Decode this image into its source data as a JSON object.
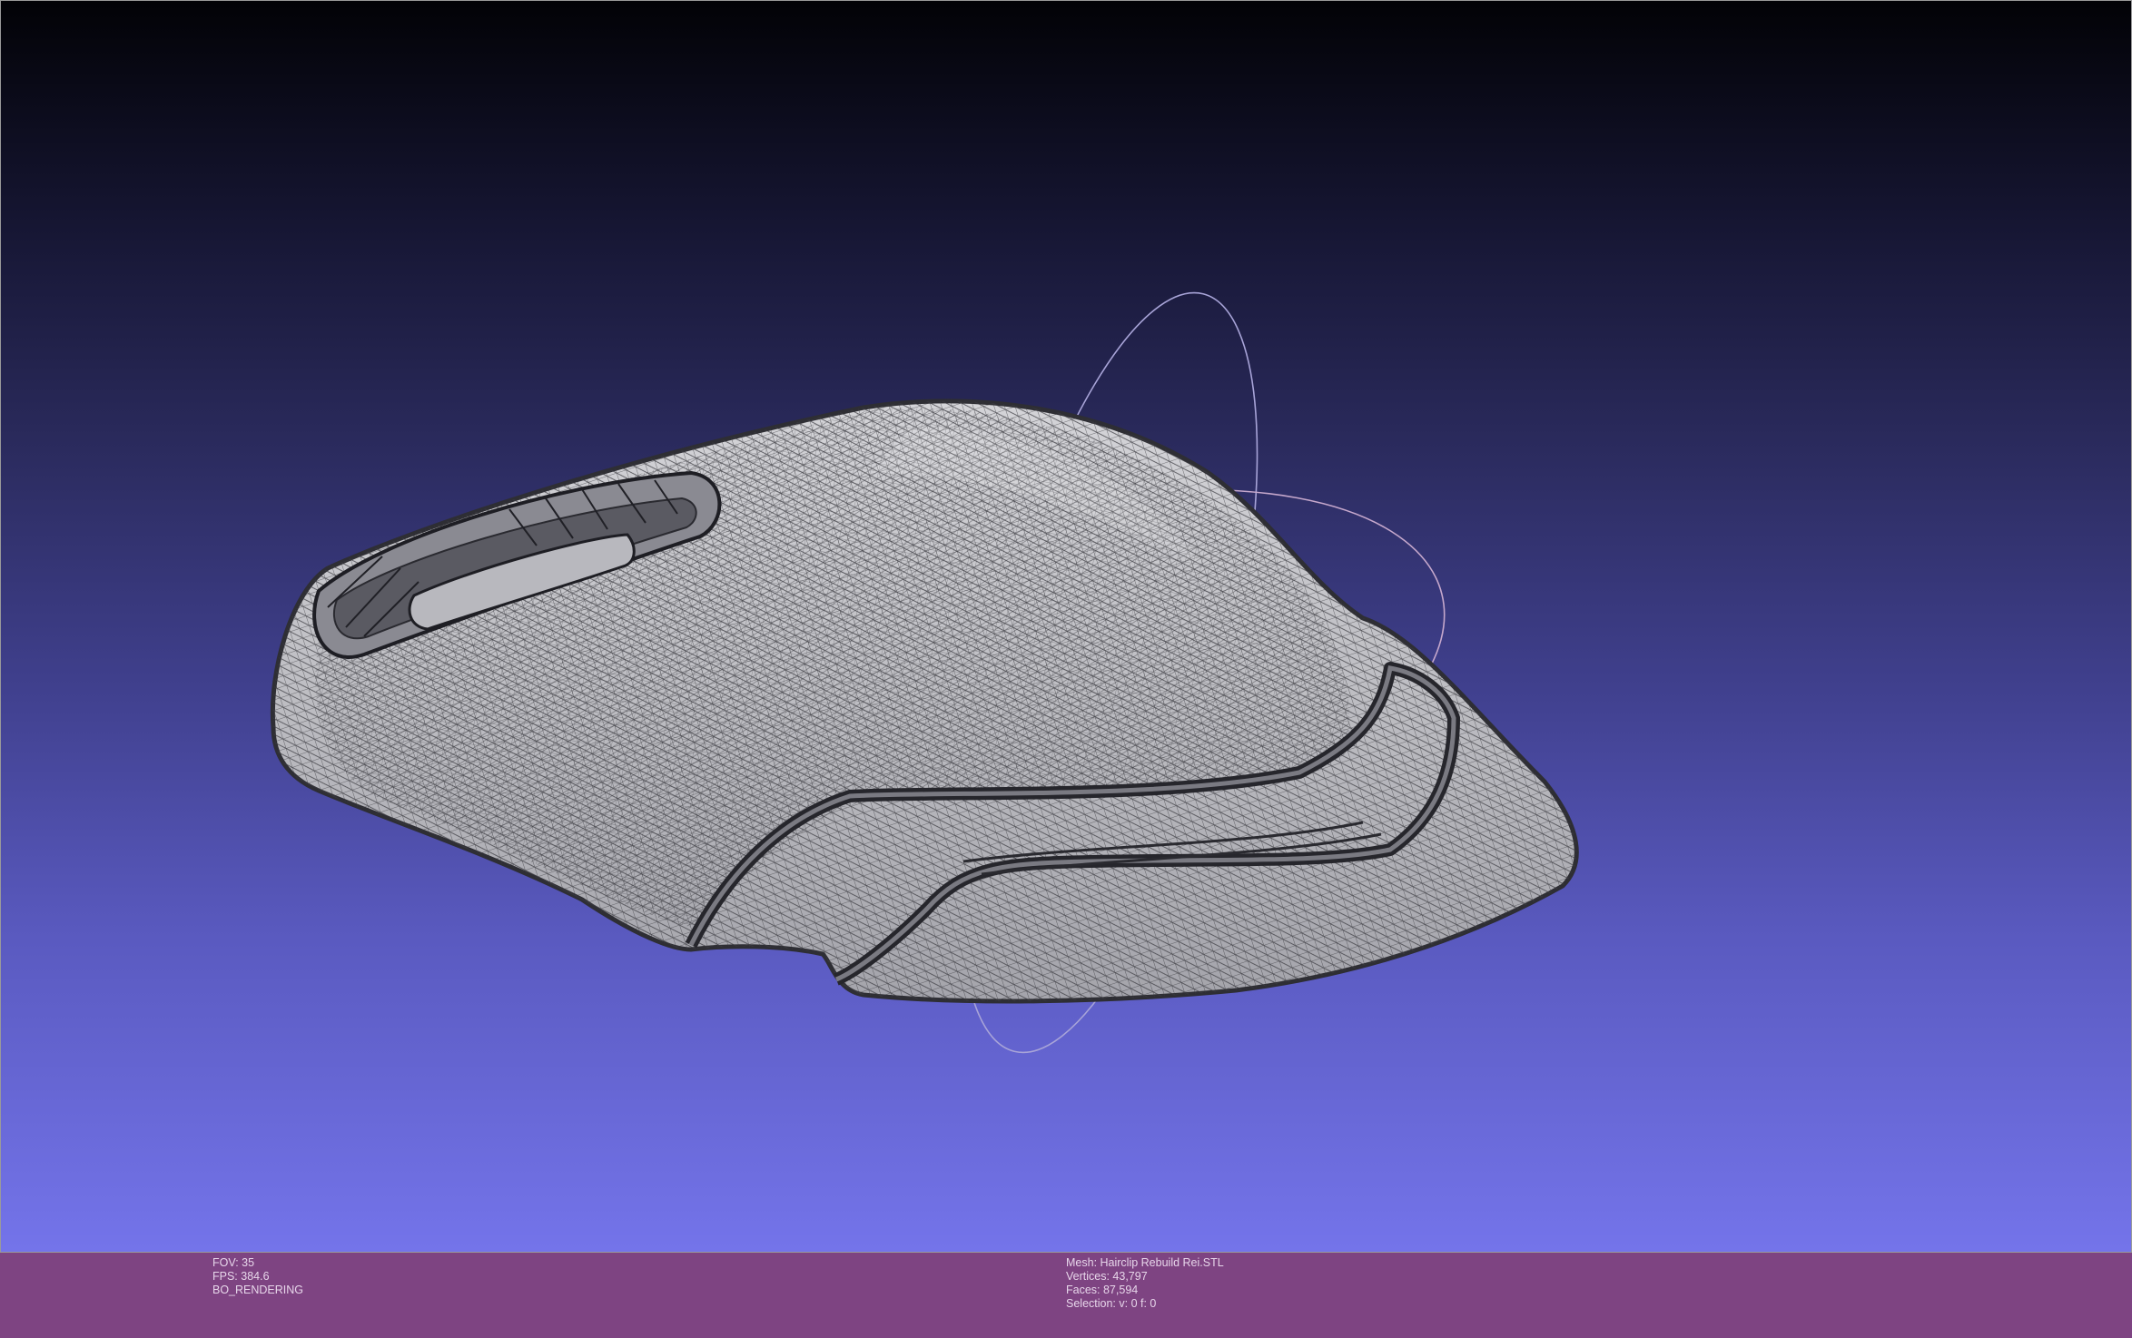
{
  "viewport": {
    "background_top": "#020206",
    "background_bottom": "#7474ea",
    "mesh_color": "#b9b9bd",
    "wire_color": "#2e2e34"
  },
  "info_left": {
    "fov": "FOV: 35",
    "fps": "FPS:   384.6",
    "rendering": "BO_RENDERING"
  },
  "info_center": {
    "mesh": "Mesh: Hairclip Rebuild Rei.STL",
    "vertices": "Vertices: 43,797",
    "faces": "Faces: 87,594",
    "selection": "Selection: v: 0 f: 0"
  },
  "infobar_color": "#7e4482"
}
